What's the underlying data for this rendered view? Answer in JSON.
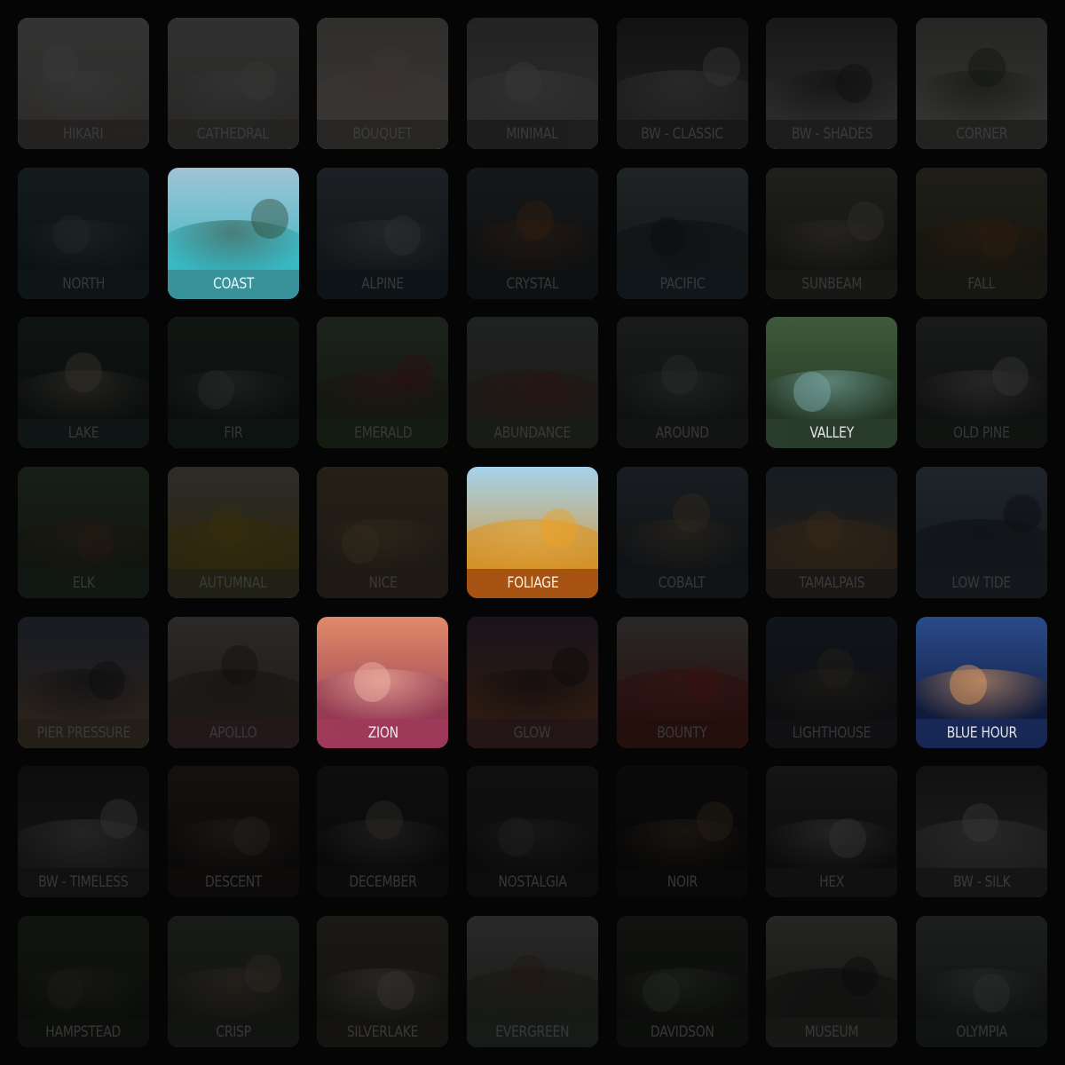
{
  "presets": [
    {
      "name": "HIKARI",
      "active": false,
      "bg": [
        "#d9d6d3",
        "#b9b4af"
      ],
      "bar": "#8b8580",
      "accent": "#f2efee"
    },
    {
      "name": "CATHEDRAL",
      "active": false,
      "bg": [
        "#c9c7c4",
        "#a7a4a0"
      ],
      "bar": "#8f8c88",
      "accent": "#e4e2df"
    },
    {
      "name": "BOUQUET",
      "active": false,
      "bg": [
        "#c7c1b6",
        "#f0e6dc"
      ],
      "bar": "#9a8f85",
      "accent": "#f6d2c6"
    },
    {
      "name": "MINIMAL",
      "active": false,
      "bg": [
        "#8d8d8d",
        "#b6b6b6"
      ],
      "bar": "#6c6c6c",
      "accent": "#e5e5e5"
    },
    {
      "name": "BW - CLASSIC",
      "active": false,
      "bg": [
        "#3f3f3f",
        "#8a8a8a"
      ],
      "bar": "#555555",
      "accent": "#dcdcdc"
    },
    {
      "name": "BW - SHADES",
      "active": false,
      "bg": [
        "#5b5b5b",
        "#b7b7b7"
      ],
      "bar": "#6a6a6a",
      "accent": "#2a2a2a"
    },
    {
      "name": "CORNER",
      "active": false,
      "bg": [
        "#9a9a92",
        "#d8d8d2"
      ],
      "bar": "#7d7d76",
      "accent": "#3b4a34"
    },
    {
      "name": "NORTH",
      "active": false,
      "bg": [
        "#4a6a70",
        "#1f3f44"
      ],
      "bar": "#2f5258",
      "accent": "#7fa0a3"
    },
    {
      "name": "COAST",
      "active": true,
      "bg": [
        "#9fc4d6",
        "#2bb6c1"
      ],
      "bar": "#3a8e94",
      "accent": "#2f4a35"
    },
    {
      "name": "ALPINE",
      "active": false,
      "bg": [
        "#6b7e8e",
        "#3b4b58"
      ],
      "bar": "#2f4658",
      "accent": "#b9c6d0"
    },
    {
      "name": "CRYSTAL",
      "active": false,
      "bg": [
        "#4e5a5f",
        "#2b3338"
      ],
      "bar": "#2e3c42",
      "accent": "#c2713a"
    },
    {
      "name": "PACIFIC",
      "active": false,
      "bg": [
        "#7b8e95",
        "#3b4a50"
      ],
      "bar": "#3a5561",
      "accent": "#1f2629"
    },
    {
      "name": "SUNBEAM",
      "active": false,
      "bg": [
        "#7a7a74",
        "#3b3a36"
      ],
      "bar": "#5a5a55",
      "accent": "#c2b79b"
    },
    {
      "name": "FALL",
      "active": false,
      "bg": [
        "#78775a",
        "#4d4a30"
      ],
      "bar": "#5b5a40",
      "accent": "#b36a2e"
    },
    {
      "name": "LAKE",
      "active": false,
      "bg": [
        "#2f4a40",
        "#1c2c28"
      ],
      "bar": "#33524d",
      "accent": "#e0c6a8"
    },
    {
      "name": "FIR",
      "active": false,
      "bg": [
        "#3b5346",
        "#1e2c24"
      ],
      "bar": "#2e4a3a",
      "accent": "#9fb0a2"
    },
    {
      "name": "EMERALD",
      "active": false,
      "bg": [
        "#6e8c6c",
        "#3e5a35"
      ],
      "bar": "#4d6d3f",
      "accent": "#b2342e"
    },
    {
      "name": "ABUNDANCE",
      "active": false,
      "bg": [
        "#7b8a8a",
        "#6b5a4a"
      ],
      "bar": "#5a6b55",
      "accent": "#a04b35"
    },
    {
      "name": "AROUND",
      "active": false,
      "bg": [
        "#5f6b66",
        "#2e3833"
      ],
      "bar": "#3f4a45",
      "accent": "#a8b0ab"
    },
    {
      "name": "VALLEY",
      "active": true,
      "bg": [
        "#3d5a3a",
        "#20301f"
      ],
      "bar": "#2b3d2d",
      "accent": "#7fb0b0"
    },
    {
      "name": "OLD PINE",
      "active": false,
      "bg": [
        "#5c6660",
        "#2e3530"
      ],
      "bar": "#3b4a3f",
      "accent": "#d7dad2"
    },
    {
      "name": "ELK",
      "active": false,
      "bg": [
        "#5a7a5a",
        "#3a4a2f"
      ],
      "bar": "#3f5a45",
      "accent": "#8a5a3a"
    },
    {
      "name": "AUTUMNAL",
      "active": false,
      "bg": [
        "#b4b4a0",
        "#b89820"
      ],
      "bar": "#7a8050",
      "accent": "#e6b81a"
    },
    {
      "name": "NICE",
      "active": false,
      "bg": [
        "#9a7a5a",
        "#6a5a42"
      ],
      "bar": "#7a6248",
      "accent": "#d8b070"
    },
    {
      "name": "FOLIAGE",
      "active": true,
      "bg": [
        "#a6d2ec",
        "#d98a12"
      ],
      "bar": "#a04a10",
      "accent": "#f0a020"
    },
    {
      "name": "COBALT",
      "active": false,
      "bg": [
        "#5e6f80",
        "#2e3c4a"
      ],
      "bar": "#3a4a5a",
      "accent": "#c8a070"
    },
    {
      "name": "TAMALPAIS",
      "active": false,
      "bg": [
        "#4a6a88",
        "#b07a4a"
      ],
      "bar": "#5a5a5a",
      "accent": "#e0a050"
    },
    {
      "name": "LOW TIDE",
      "active": false,
      "bg": [
        "#7a95b0",
        "#3a4d60"
      ],
      "bar": "#4a6070",
      "accent": "#1f2833"
    },
    {
      "name": "PIER PRESSURE",
      "active": false,
      "bg": [
        "#5a6a8a",
        "#b08a6a"
      ],
      "bar": "#8a7a5a",
      "accent": "#1f2028"
    },
    {
      "name": "APOLLO",
      "active": false,
      "bg": [
        "#b4aaa8",
        "#6a5a48"
      ],
      "bar": "#8a5a68",
      "accent": "#3a3028"
    },
    {
      "name": "ZION",
      "active": true,
      "bg": [
        "#e08a6a",
        "#8a3050"
      ],
      "bar": "#a03a5a",
      "accent": "#f2b8a8"
    },
    {
      "name": "GLOW",
      "active": false,
      "bg": [
        "#6a4a6a",
        "#c06a3a"
      ],
      "bar": "#8a4a5a",
      "accent": "#1c1418"
    },
    {
      "name": "BOUNTY",
      "active": false,
      "bg": [
        "#a8a29a",
        "#9a2a2a"
      ],
      "bar": "#8a3a2a",
      "accent": "#e0372f"
    },
    {
      "name": "LIGHTHOUSE",
      "active": false,
      "bg": [
        "#3a4a6a",
        "#2a2a30"
      ],
      "bar": "#3a3a48",
      "accent": "#8a7a5a"
    },
    {
      "name": "BLUE HOUR",
      "active": true,
      "bg": [
        "#2a4a8a",
        "#0c1430"
      ],
      "bar": "#1a2a5a",
      "accent": "#e8a060"
    },
    {
      "name": "BW - TIMELESS",
      "active": false,
      "bg": [
        "#2a2a2a",
        "#505050"
      ],
      "bar": "#3a3a3a",
      "accent": "#d8d8d8"
    },
    {
      "name": "DESCENT",
      "active": false,
      "bg": [
        "#4a3a30",
        "#1a1614"
      ],
      "bar": "#2a2220",
      "accent": "#8a7a70"
    },
    {
      "name": "DECEMBER",
      "active": false,
      "bg": [
        "#2e2e2e",
        "#151515"
      ],
      "bar": "#262626",
      "accent": "#b0a8a0"
    },
    {
      "name": "NOSTALGIA",
      "active": false,
      "bg": [
        "#3a3a3e",
        "#1e1e22"
      ],
      "bar": "#2a2a2e",
      "accent": "#7a7a80"
    },
    {
      "name": "NOIR",
      "active": false,
      "bg": [
        "#1e1e1e",
        "#0c0c0c"
      ],
      "bar": "#1a1a1a",
      "accent": "#9a7a50"
    },
    {
      "name": "HEX",
      "active": false,
      "bg": [
        "#4a4a4a",
        "#1e1e1e"
      ],
      "bar": "#3a3a3a",
      "accent": "#d0d0d0"
    },
    {
      "name": "BW - SILK",
      "active": false,
      "bg": [
        "#3a3a3a",
        "#7a7a7a"
      ],
      "bar": "#4a4a4a",
      "accent": "#e0e0e0"
    },
    {
      "name": "HAMPSTEAD",
      "active": false,
      "bg": [
        "#3a4a30",
        "#1e2818"
      ],
      "bar": "#2a3622",
      "accent": "#6a6a5a"
    },
    {
      "name": "CRISP",
      "active": false,
      "bg": [
        "#5a6a5a",
        "#3a4038"
      ],
      "bar": "#3e4a3e",
      "accent": "#c09a80"
    },
    {
      "name": "SILVERLAKE",
      "active": false,
      "bg": [
        "#6a6050",
        "#3a3a2a"
      ],
      "bar": "#4a4638",
      "accent": "#e0d8c8"
    },
    {
      "name": "EVERGREEN",
      "active": false,
      "bg": [
        "#a8aaa8",
        "#4a5a48"
      ],
      "bar": "#5a6a58",
      "accent": "#7a5040"
    },
    {
      "name": "DAVIDSON",
      "active": false,
      "bg": [
        "#3a4238",
        "#1c221c"
      ],
      "bar": "#2a3228",
      "accent": "#8a9a80"
    },
    {
      "name": "MUSEUM",
      "active": false,
      "bg": [
        "#9a9890",
        "#3a3a36"
      ],
      "bar": "#5a5a54",
      "accent": "#1a1a1a"
    },
    {
      "name": "OLYMPIA",
      "active": false,
      "bg": [
        "#6a7a72",
        "#2e3a32"
      ],
      "bar": "#3a4a40",
      "accent": "#a8b8b0"
    }
  ]
}
